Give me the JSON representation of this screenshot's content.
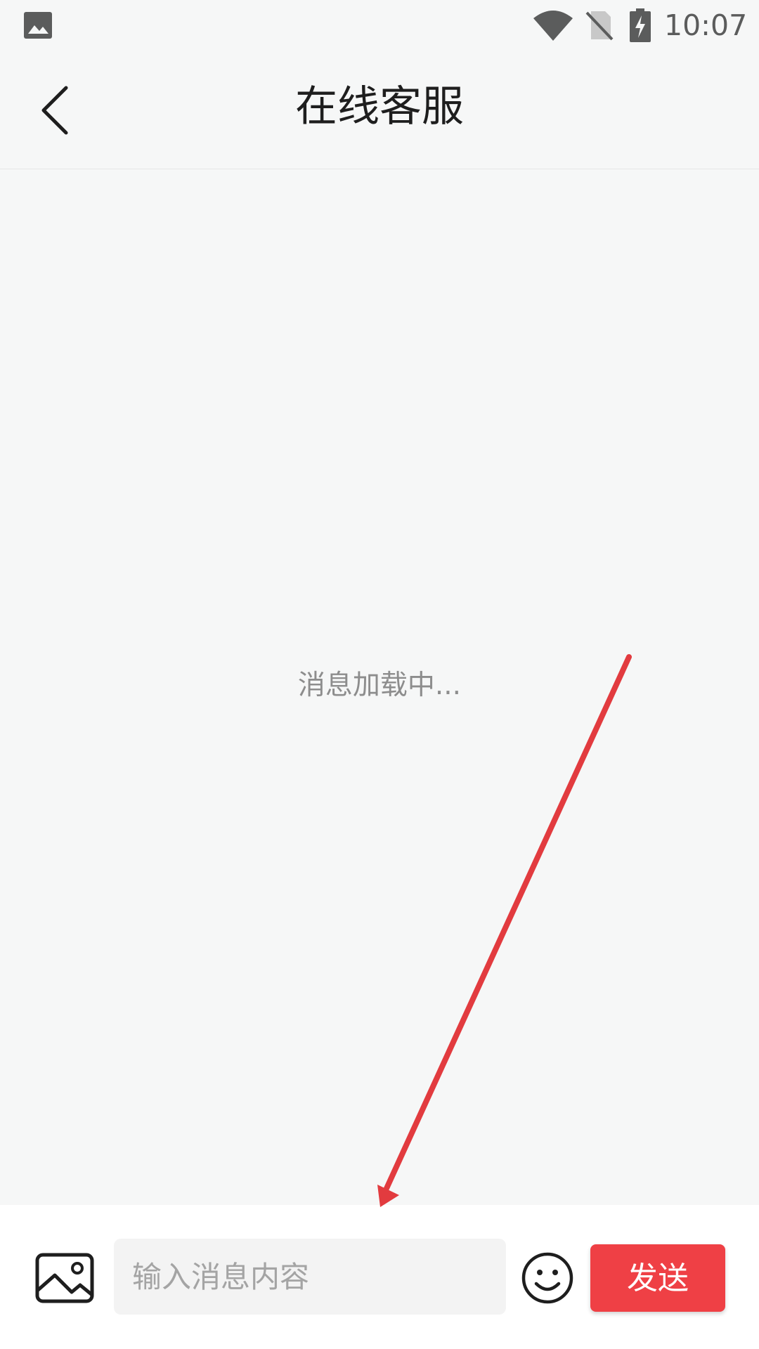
{
  "status_bar": {
    "time": "10:07",
    "icons": [
      "image-notification-icon",
      "wifi-icon",
      "no-sim-icon",
      "battery-charging-icon"
    ]
  },
  "header": {
    "title": "在线客服",
    "back_icon": "chevron-left-icon"
  },
  "chat": {
    "loading_text": "消息加载中..."
  },
  "composer": {
    "image_icon": "image-icon",
    "input_placeholder": "输入消息内容",
    "input_value": "",
    "emoji_icon": "emoji-icon",
    "send_label": "发送"
  },
  "colors": {
    "background": "#f6f7f7",
    "accent": "#ef4045",
    "annotation_arrow": "#e23b3f"
  }
}
